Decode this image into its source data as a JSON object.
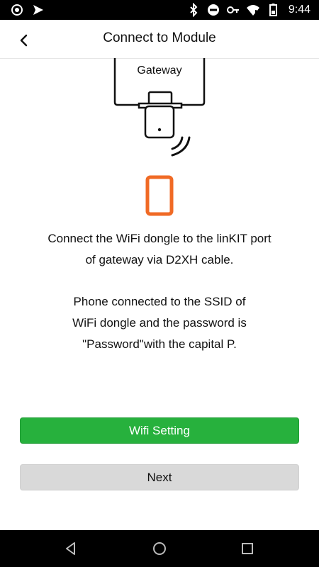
{
  "status_bar": {
    "time": "9:44",
    "left_icons": [
      "circle-app-icon",
      "send-icon"
    ],
    "right_icons": [
      "bluetooth-icon",
      "do-not-disturb-icon",
      "key-icon",
      "wifi-icon",
      "battery-icon"
    ]
  },
  "header": {
    "title": "Connect to Module",
    "back_icon": "chevron-left-icon"
  },
  "illustration": {
    "gateway_label": "Gateway",
    "accent_color": "#f06a25"
  },
  "instructions": {
    "line1": "Connect the WiFi dongle to the linKIT port",
    "line2": "of gateway via D2XH cable.",
    "line3": "Phone connected to the SSID of",
    "line4": "WiFi dongle and the password is",
    "line5": "\"Password\"with the capital P."
  },
  "buttons": {
    "wifi_setting": "Wifi Setting",
    "next": "Next"
  },
  "colors": {
    "primary_green": "#27b13d",
    "secondary_gray": "#d9d9d9",
    "status_bar": "#000000"
  },
  "nav_bar": {
    "icons": [
      "back-triangle-icon",
      "home-circle-icon",
      "recents-square-icon"
    ]
  }
}
